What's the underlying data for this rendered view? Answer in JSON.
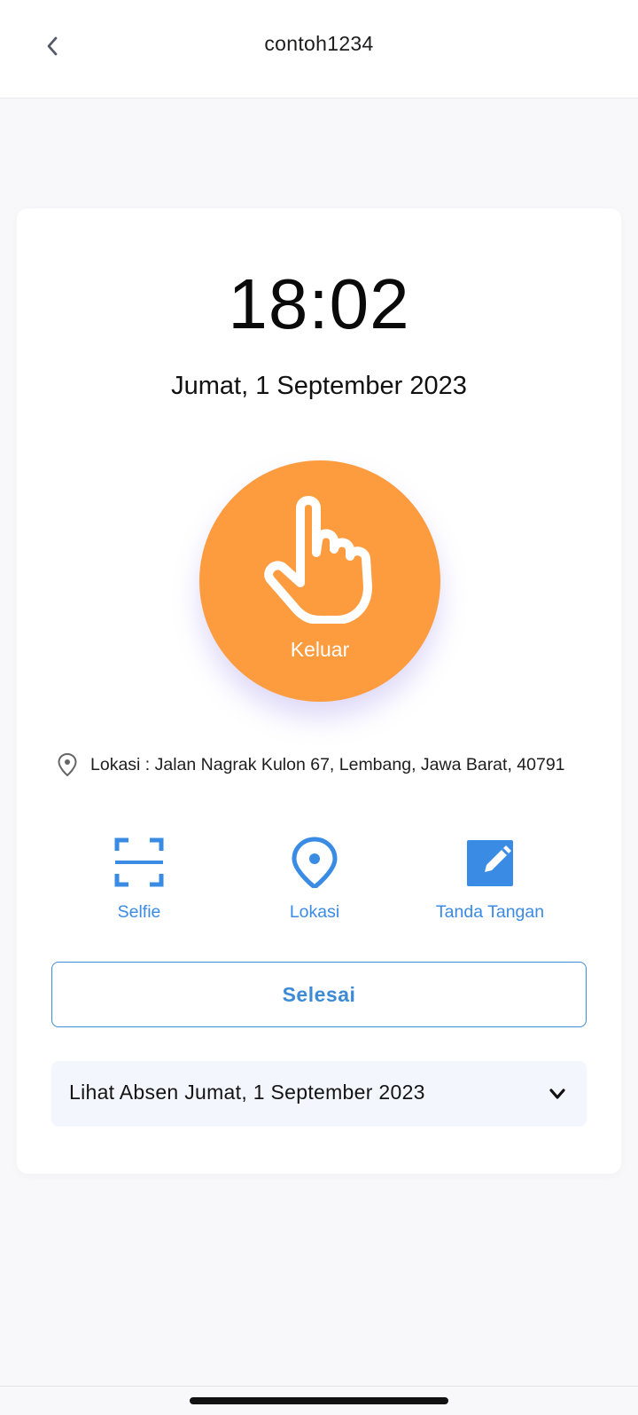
{
  "header": {
    "title": "contoh1234",
    "back_icon": "chevron-left-icon"
  },
  "attendance": {
    "time": "18:02",
    "date": "Jumat, 1 September 2023",
    "punch_button": {
      "label": "Keluar",
      "icon": "hand-pointer-icon",
      "color": "#fd9b3f"
    },
    "location": {
      "icon": "map-pin-outline-icon",
      "text": "Lokasi : Jalan Nagrak Kulon 67, Lembang, Jawa Barat, 40791"
    }
  },
  "actions": [
    {
      "label": "Selfie",
      "icon": "scan-frame-icon"
    },
    {
      "label": "Lokasi",
      "icon": "location-pin-icon"
    },
    {
      "label": "Tanda Tangan",
      "icon": "edit-signature-icon"
    }
  ],
  "done_button": {
    "label": "Selesai"
  },
  "history": {
    "label": "Lihat Absen Jumat, 1 September 2023",
    "icon": "chevron-down-icon"
  },
  "colors": {
    "accent_blue": "#3a8be4",
    "punch_orange": "#fd9b3f",
    "background": "#f8f8fa"
  }
}
